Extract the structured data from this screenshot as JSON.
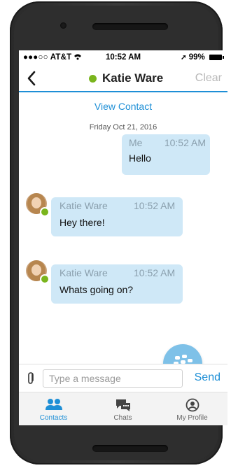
{
  "status": {
    "carrier": "●●●○○ AT&T",
    "time": "10:52 AM",
    "battery": "99%"
  },
  "header": {
    "title": "Katie Ware",
    "clear_label": "Clear"
  },
  "chat": {
    "view_contact": "View Contact",
    "date": "Friday Oct 21, 2016",
    "messages": [
      {
        "sender": "Me",
        "time": "10:52 AM",
        "text": "Hello"
      },
      {
        "sender": "Katie Ware",
        "time": "10:52 AM",
        "text": "Hey there!"
      },
      {
        "sender": "Katie Ware",
        "time": "10:52 AM",
        "text": "Whats going on?"
      }
    ]
  },
  "composer": {
    "placeholder": "Type a message",
    "send_label": "Send"
  },
  "tabs": [
    {
      "label": "Contacts",
      "icon": "contacts-icon",
      "active": true
    },
    {
      "label": "Chats",
      "icon": "chats-icon",
      "active": false
    },
    {
      "label": "My Profile",
      "icon": "profile-icon",
      "active": false
    }
  ],
  "colors": {
    "accent": "#1e8fd6",
    "presence": "#7ab51d",
    "bubble": "#cfe8f7"
  }
}
